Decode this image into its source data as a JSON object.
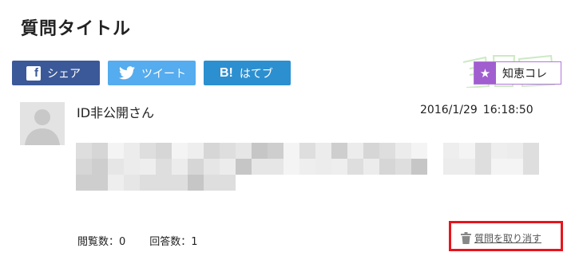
{
  "page": {
    "title": "質問タイトル"
  },
  "share": {
    "facebook_label": "シェア",
    "twitter_label": "ツイート",
    "hatena_label": "はてブ",
    "hatena_mark": "B!",
    "facebook_mark": "f"
  },
  "chiekore": {
    "label": "知恵コレ",
    "star": "★",
    "accent_color": "#a15ecf"
  },
  "question": {
    "user": "ID非公開さん",
    "date": "2016/1/29",
    "time": "16:18:50",
    "body_obscured": true
  },
  "stats": {
    "views": "閲覧数：0",
    "answers": "回答数：1"
  },
  "actions": {
    "cancel_label": "質問を取り消す",
    "highlight_color": "#e8141c"
  },
  "colors": {
    "facebook": "#3b5998",
    "twitter": "#55acee",
    "hatena": "#2c8fd0"
  },
  "icons": {
    "facebook": "facebook-icon",
    "twitter": "twitter-bird-icon",
    "hatena": "hatena-bookmark-icon",
    "star": "star-icon",
    "avatar": "default-avatar-icon",
    "trash": "trash-icon"
  }
}
